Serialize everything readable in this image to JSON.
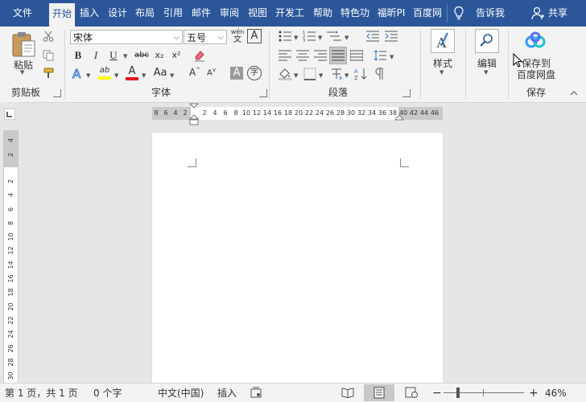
{
  "tabs": [
    {
      "label": "文件"
    },
    {
      "label": "开始"
    },
    {
      "label": "插入"
    },
    {
      "label": "设计"
    },
    {
      "label": "布局"
    },
    {
      "label": "引用"
    },
    {
      "label": "邮件"
    },
    {
      "label": "审阅"
    },
    {
      "label": "视图"
    },
    {
      "label": "开发工"
    },
    {
      "label": "帮助"
    },
    {
      "label": "特色功"
    },
    {
      "label": "福昕PI"
    },
    {
      "label": "百度网"
    }
  ],
  "tellme": "告诉我",
  "share": "共享",
  "ribbon": {
    "clipboard": {
      "label": "剪贴板",
      "paste": "粘贴"
    },
    "font": {
      "label": "字体",
      "font_name": "宋体",
      "font_size": "五号",
      "wen_top": "wén",
      "wen_bottom": "文",
      "bold": "B",
      "italic": "I",
      "underline": "U",
      "strike": "abc",
      "subscript": "x₂",
      "superscript": "x²",
      "highlight": "ab",
      "fontcolor": "A",
      "changecase": "Aa",
      "grow": "A",
      "shrink": "A",
      "char_shading": "A",
      "enclose": "字",
      "text_effect": "A"
    },
    "paragraph": {
      "label": "段落"
    },
    "styles": {
      "label": "样式"
    },
    "editing": {
      "label": "编辑"
    },
    "save": {
      "label": "保存",
      "button_line1": "保存到",
      "button_line2": "百度网盘"
    }
  },
  "ruler": {
    "h_left": [
      "8",
      "6",
      "4",
      "2"
    ],
    "h_main": [
      "2",
      "4",
      "6",
      "8",
      "10",
      "12",
      "14",
      "16",
      "18",
      "20",
      "22",
      "24",
      "26",
      "28",
      "30",
      "32",
      "34",
      "36",
      "38"
    ],
    "h_right": [
      "40",
      "42",
      "44",
      "46"
    ],
    "v_top": [
      "4",
      "2"
    ],
    "v_main": [
      "2",
      "4",
      "6",
      "8",
      "10",
      "12",
      "14",
      "16",
      "18",
      "20",
      "22",
      "24",
      "26",
      "28",
      "30"
    ]
  },
  "status": {
    "page": "第 1 页，共 1 页",
    "words": "0 个字",
    "language": "中文(中国)",
    "mode": "插入",
    "zoom_minus": "−",
    "zoom_plus": "+",
    "zoom": "46%"
  },
  "colors": {
    "brand": "#2b579a",
    "highlight": "#ffff00",
    "font_red": "#e81123",
    "baidu_blue": "#2f9bff"
  }
}
